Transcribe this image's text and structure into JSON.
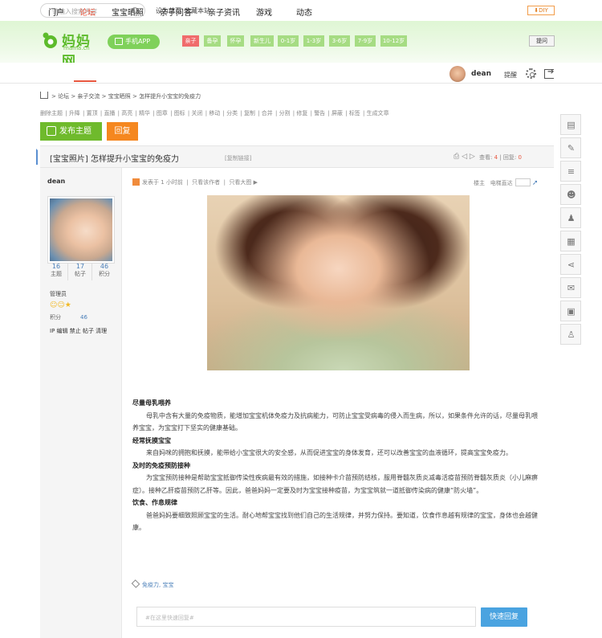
{
  "topbar": {
    "search_placeholder": "请输入搜索内容",
    "set_home": "设为首页",
    "bookmark": "收藏本站",
    "diy": "DIY"
  },
  "banner": {
    "logo_cn": "妈妈网",
    "logo_en": "mama.cn",
    "app_label": "手机APP",
    "stages": [
      "亲子",
      "备孕",
      "怀孕",
      "新生儿",
      "0-1岁",
      "1-3岁",
      "3-6岁",
      "7-9岁",
      "10-12岁"
    ],
    "ask_label": "提问"
  },
  "nav": {
    "items": [
      "门户",
      "论坛",
      "宝宝晒照",
      "亲子问答",
      "亲子资讯",
      "游戏",
      "动态"
    ],
    "user": "dean",
    "remind": "提醒"
  },
  "breadcrumb": [
    "论坛",
    "亲子交流",
    "宝宝晒照",
    "怎样提升小宝宝的免疫力"
  ],
  "mod_actions": [
    "删除主题",
    "升降",
    "置顶",
    "直播",
    "高亮",
    "精华",
    "图章",
    "图标",
    "关闭",
    "移动",
    "分类",
    "复制",
    "合并",
    "分割",
    "修复",
    "警告",
    "屏蔽",
    "标签",
    "生成文章"
  ],
  "buttons": {
    "post": "发布主题",
    "reply": "回复"
  },
  "thread": {
    "category": "[宝宝照片]",
    "title": "怎样提升小宝宝的免疫力",
    "copy_link": "[复制链接]",
    "views_label": "查看:",
    "views": "4",
    "replies_label": "回复:",
    "replies": "0"
  },
  "author": {
    "name": "dean",
    "stats": [
      {
        "value": "16",
        "label": "主题"
      },
      {
        "value": "17",
        "label": "帖子"
      },
      {
        "value": "46",
        "label": "积分"
      }
    ],
    "role": "管理员",
    "credit_label": "积分",
    "credit": "46",
    "actions": "IP  编辑  禁止  帖子  清理"
  },
  "post": {
    "meta_posted": "发表于 1 小时前",
    "meta_author_only": "只看该作者",
    "meta_big_image": "只看大图",
    "floor_label": "楼主",
    "jump_label": "电梯直达",
    "sections": [
      {
        "heading": "尽量母乳喂养",
        "text": "母乳中含有大量的免疫物质，能增加宝宝机体免疫力及抗病能力，可防止宝宝受病毒的侵入而生病，所以，如果条件允许的话，尽量母乳喂养宝宝，为宝宝打下坚实的健康基础。"
      },
      {
        "heading": "经常抚摸宝宝",
        "text": "来自妈咪的拥抱和抚摸，能带给小宝宝很大的安全感，从而促进宝宝的身体发育，还可以改善宝宝的血液循环，提高宝宝免疫力。"
      },
      {
        "heading": "及时的免疫预防接种",
        "text": "为宝宝预防接种是帮助宝宝抵御传染性疾病最有效的措施，如接种卡介苗预防结核，服用脊髓灰质炎减毒活疫苗预防脊髓灰质炎（小儿麻痹症）。接种乙肝疫苗预防乙肝等。因此，爸爸妈妈一定要及时为宝宝接种疫苗，为宝宝筑就一道抵御传染病的健康“防火墙”。"
      },
      {
        "heading": "饮食、作息规律",
        "text": "爸爸妈妈要细致照顾宝宝的生活。耐心地帮宝宝找到他们自己的生活规律，并努力保持。要知道，饮食作息越有规律的宝宝，身体也会越健康。"
      }
    ],
    "tags": "免疫力, 宝宝"
  },
  "quick_reply": {
    "placeholder": "#在这里快速回复#",
    "button": "快速回复"
  },
  "side_tools": [
    "note-icon",
    "edit-icon",
    "list-icon",
    "robot-icon",
    "qq-icon",
    "grid-icon",
    "share-icon",
    "wechat-icon",
    "qrcode-icon",
    "user-icon"
  ]
}
